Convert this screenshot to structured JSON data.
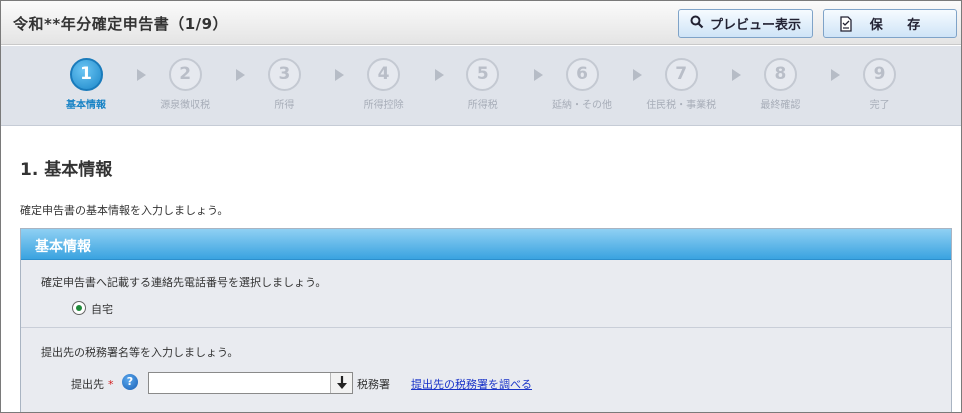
{
  "header": {
    "title": "令和**年分確定申告書（1/9）",
    "preview_label": "プレビュー表示",
    "save_label": "保 存",
    "preview_icon": "search-icon",
    "save_icon": "save-document-icon"
  },
  "steps": [
    {
      "number": "1",
      "label": "基本情報",
      "active": true
    },
    {
      "number": "2",
      "label": "源泉徴収税",
      "active": false
    },
    {
      "number": "3",
      "label": "所得",
      "active": false
    },
    {
      "number": "4",
      "label": "所得控除",
      "active": false
    },
    {
      "number": "5",
      "label": "所得税",
      "active": false
    },
    {
      "number": "6",
      "label": "延納・その他",
      "active": false
    },
    {
      "number": "7",
      "label": "住民税・事業税",
      "active": false
    },
    {
      "number": "8",
      "label": "最終確認",
      "active": false
    },
    {
      "number": "9",
      "label": "完了",
      "active": false
    }
  ],
  "main": {
    "title": "1.  基本情報",
    "intro": "確定申告書の基本情報を入力しましょう。"
  },
  "panel": {
    "heading": "基本情報",
    "phone_question": "確定申告書へ記載する連絡先電話番号を選択しましょう。",
    "phone_option": "自宅",
    "office_question": "提出先の税務署名等を入力しましょう。",
    "office_label": "提出先",
    "required_mark": "*",
    "help_glyph": "?",
    "office_value": "",
    "office_unit": "税務署",
    "lookup_link": "提出先の税務署を調べる"
  },
  "colors": {
    "accent": "#1a84c6",
    "panel_header": "#3aa3e0",
    "required": "#d21b1b",
    "link": "#1a34c8"
  }
}
